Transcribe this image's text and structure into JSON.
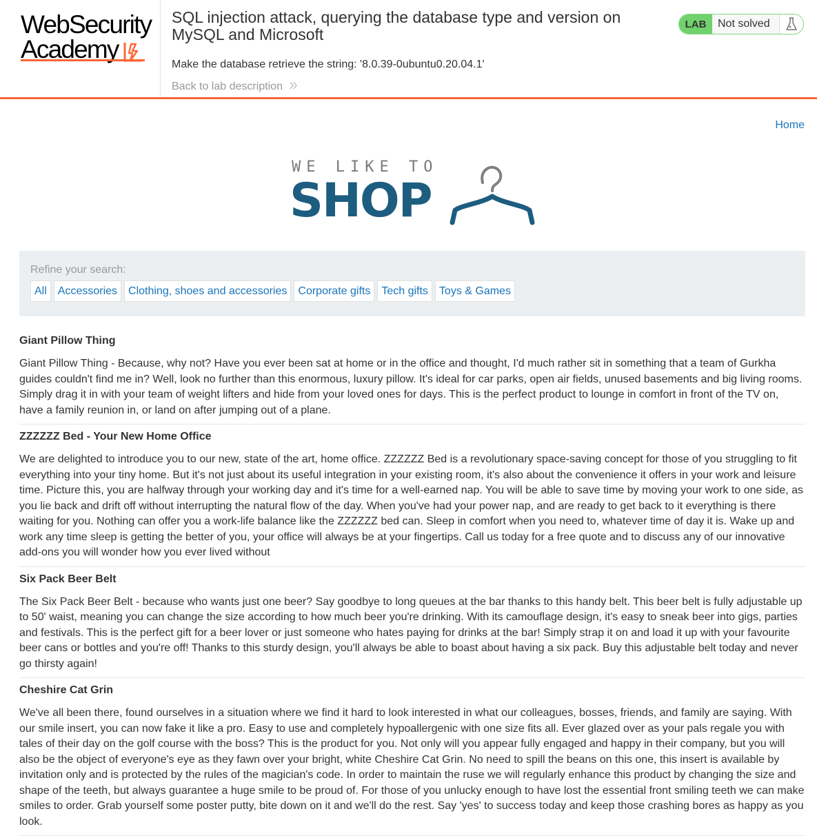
{
  "brand": {
    "line1": "WebSecurity",
    "line2": "Academy"
  },
  "lab": {
    "title": "SQL injection attack, querying the database type and version on MySQL and Microsoft",
    "goal": "Make the database retrieve the string: '8.0.39-0ubuntu0.20.04.1'",
    "back_link": "Back to lab description",
    "status_badge": "LAB",
    "status_text": "Not solved"
  },
  "nav": {
    "home": "Home"
  },
  "shop_logo": {
    "tagline": "WE LIKE TO",
    "word": "SHOP"
  },
  "filters": {
    "label": "Refine your search:",
    "items": [
      "All",
      "Accessories",
      "Clothing, shoes and accessories",
      "Corporate gifts",
      "Tech gifts",
      "Toys & Games"
    ]
  },
  "products": [
    {
      "title": "Giant Pillow Thing",
      "description": "Giant Pillow Thing - Because, why not? Have you ever been sat at home or in the office and thought, I'd much rather sit in something that a team of Gurkha guides couldn't find me in? Well, look no further than this enormous, luxury pillow. It's ideal for car parks, open air fields, unused basements and big living rooms. Simply drag it in with your team of weight lifters and hide from your loved ones for days. This is the perfect product to lounge in comfort in front of the TV on, have a family reunion in, or land on after jumping out of a plane."
    },
    {
      "title": "ZZZZZZ Bed - Your New Home Office",
      "description": "We are delighted to introduce you to our new, state of the art, home office. ZZZZZZ Bed is a revolutionary space-saving concept for those of you struggling to fit everything into your tiny home. But it's not just about its useful integration in your existing room, it's also about the convenience it offers in your work and leisure time. Picture this, you are halfway through your working day and it's time for a well-earned nap. You will be able to save time by moving your work to one side, as you lie back and drift off without interrupting the natural flow of the day. When you've had your power nap, and are ready to get back to it everything is there waiting for you. Nothing can offer you a work-life balance like the ZZZZZZ bed can. Sleep in comfort when you need to, whatever time of day it is. Wake up and work any time sleep is getting the better of you, your office will always be at your fingertips. Call us today for a free quote and to discuss any of our innovative add-ons you will wonder how you ever lived without"
    },
    {
      "title": "Six Pack Beer Belt",
      "description": "The Six Pack Beer Belt - because who wants just one beer? Say goodbye to long queues at the bar thanks to this handy belt. This beer belt is fully adjustable up to 50' waist, meaning you can change the size according to how much beer you're drinking. With its camouflage design, it's easy to sneak beer into gigs, parties and festivals. This is the perfect gift for a beer lover or just someone who hates paying for drinks at the bar! Simply strap it on and load it up with your favourite beer cans or bottles and you're off! Thanks to this sturdy design, you'll always be able to boast about having a six pack. Buy this adjustable belt today and never go thirsty again!"
    },
    {
      "title": "Cheshire Cat Grin",
      "description": "We've all been there, found ourselves in a situation where we find it hard to look interested in what our colleagues, bosses, friends, and family are saying. With our smile insert, you can now fake it like a pro. Easy to use and completely hypoallergenic with one size fits all. Ever glazed over as your pals regale you with tales of their day on the golf course with the boss? This is the product for you. Not only will you appear fully engaged and happy in their company, but you will also be the object of everyone's eye as they fawn over your bright, white Cheshire Cat Grin. No need to spill the beans on this one, this insert is available by invitation only and is protected by the rules of the magician's code. In order to maintain the ruse we will regularly enhance this product by changing the size and shape of the teeth, but always guarantee a huge smile to be proud of. For those of you unlucky enough to have lost the essential front smiling teeth we can make smiles to order. Grab yourself some poster putty, bite down on it and we'll do the rest. Say 'yes' to success today and keep those crashing bores as happy as you look."
    }
  ],
  "colors": {
    "accent_orange": "#ff6633",
    "link_blue": "#1a75bb",
    "status_green": "#70d16d",
    "shop_blue": "#1d5d7f",
    "filter_bg": "#ebeff2"
  },
  "icons": {
    "logo_mark": "academy-lightning-icon",
    "back_chevron": "double-chevron-right-icon",
    "status": "flask-icon",
    "shop_logo": "hanger-icon"
  }
}
